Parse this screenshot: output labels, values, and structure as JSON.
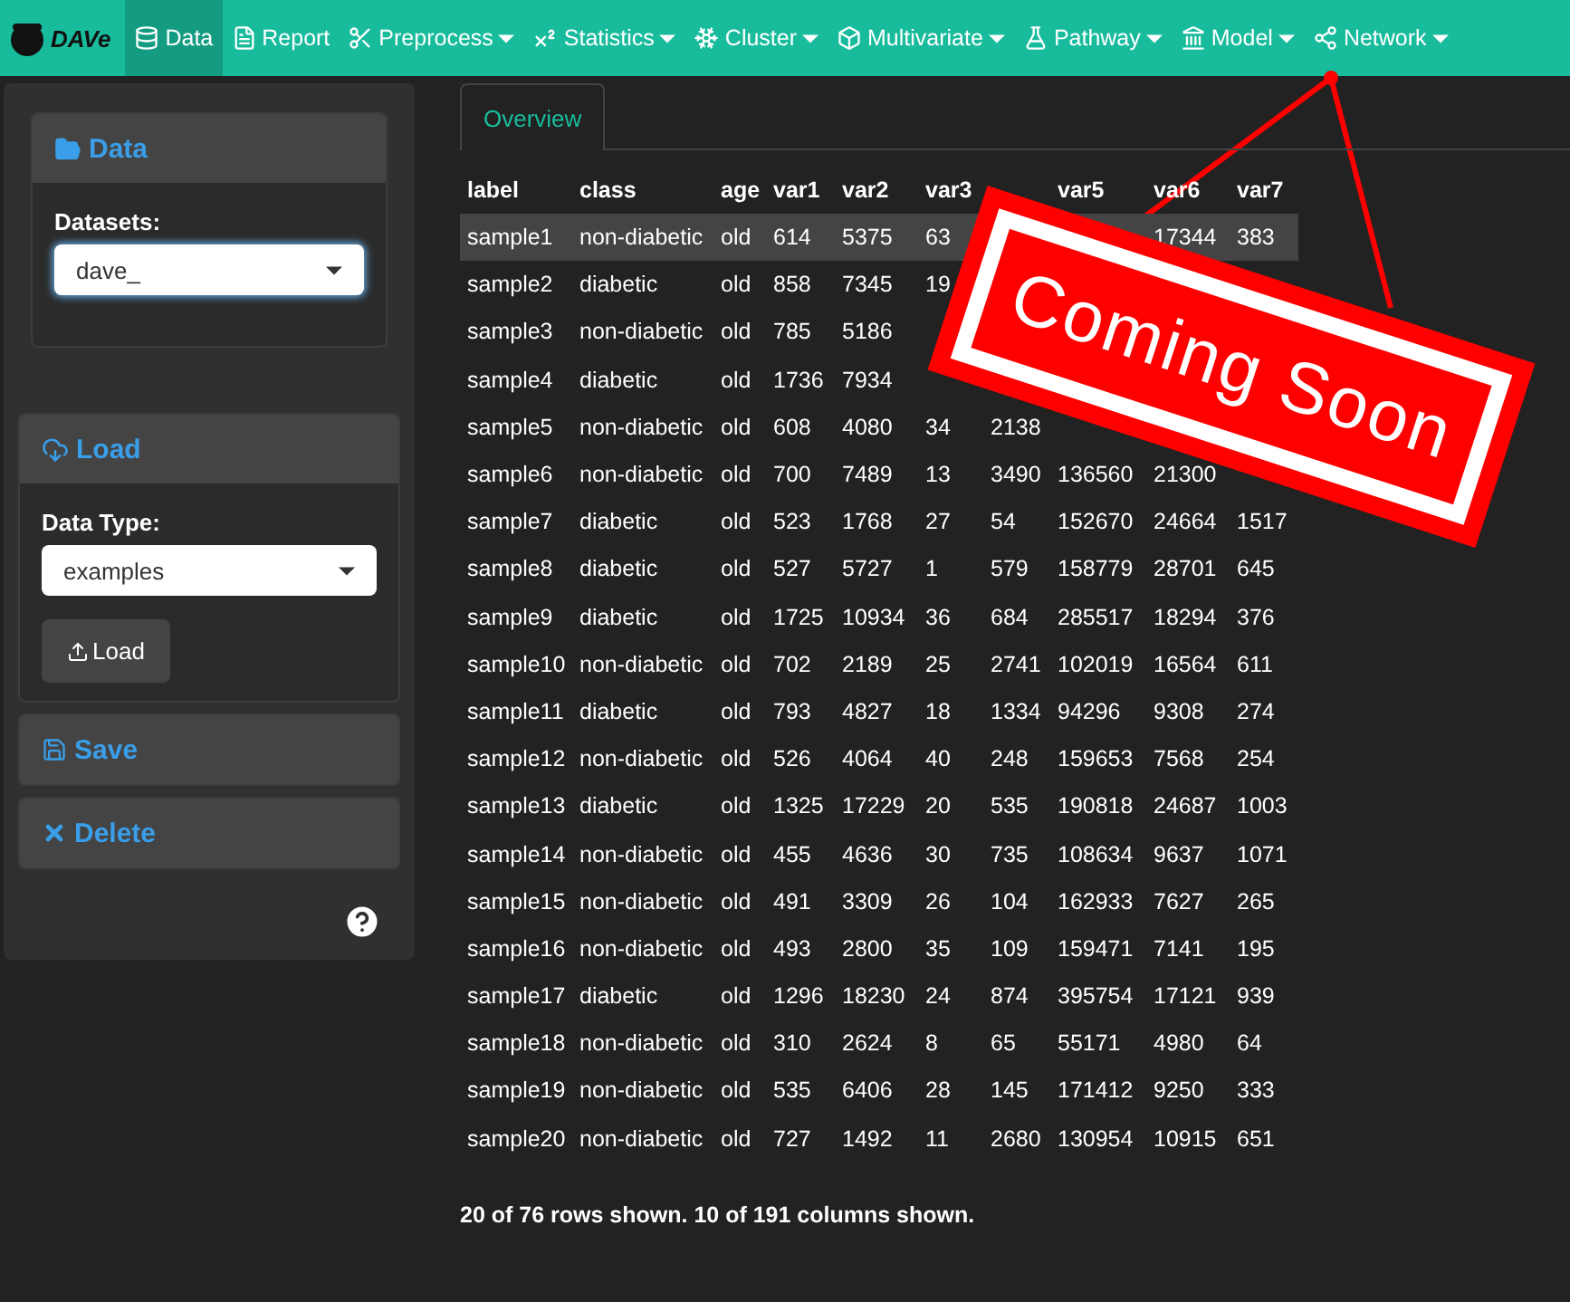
{
  "navbar": {
    "brand": "DAVe",
    "items": [
      {
        "label": "Data",
        "selected": true,
        "dropdown": false
      },
      {
        "label": "Report",
        "selected": false,
        "dropdown": false
      },
      {
        "label": "Preprocess",
        "selected": false,
        "dropdown": true
      },
      {
        "label": "Statistics",
        "selected": false,
        "dropdown": true
      },
      {
        "label": "Cluster",
        "selected": false,
        "dropdown": true
      },
      {
        "label": "Multivariate",
        "selected": false,
        "dropdown": true
      },
      {
        "label": "Pathway",
        "selected": false,
        "dropdown": true
      },
      {
        "label": "Model",
        "selected": false,
        "dropdown": true
      },
      {
        "label": "Network",
        "selected": false,
        "dropdown": true
      }
    ]
  },
  "sidebar": {
    "data_panel": {
      "title": "Data",
      "field_label": "Datasets:",
      "value": "dave_"
    },
    "load_panel": {
      "title": "Load",
      "field_label": "Data Type:",
      "value": "examples",
      "button": "Load"
    },
    "save_panel": {
      "title": "Save"
    },
    "delete_panel": {
      "title": "Delete"
    }
  },
  "tabs": [
    {
      "label": "Overview",
      "selected": true
    }
  ],
  "table": {
    "columns": [
      "label",
      "class",
      "age",
      "var1",
      "var2",
      "var3",
      null,
      "var5",
      "var6",
      "var7"
    ],
    "rows": [
      {
        "selected": true,
        "cells": [
          "sample1",
          "non-diabetic",
          "old",
          "614",
          "5375",
          "63",
          null,
          null,
          "17344",
          "383"
        ]
      },
      {
        "selected": false,
        "cells": [
          "sample2",
          "diabetic",
          "old",
          "858",
          "7345",
          "19",
          null,
          null,
          null,
          null
        ]
      },
      {
        "selected": false,
        "cells": [
          "sample3",
          "non-diabetic",
          "old",
          "785",
          "5186",
          null,
          null,
          null,
          null,
          null
        ]
      },
      {
        "selected": false,
        "cells": [
          "sample4",
          "diabetic",
          "old",
          "1736",
          "7934",
          null,
          null,
          null,
          null,
          null
        ]
      },
      {
        "selected": false,
        "cells": [
          "sample5",
          "non-diabetic",
          "old",
          "608",
          "4080",
          "34",
          "2138",
          null,
          null,
          null
        ]
      },
      {
        "selected": false,
        "cells": [
          "sample6",
          "non-diabetic",
          "old",
          "700",
          "7489",
          "13",
          "3490",
          "136560",
          "21300",
          null
        ]
      },
      {
        "selected": false,
        "cells": [
          "sample7",
          "diabetic",
          "old",
          "523",
          "1768",
          "27",
          "54",
          "152670",
          "24664",
          "1517"
        ]
      },
      {
        "selected": false,
        "cells": [
          "sample8",
          "diabetic",
          "old",
          "527",
          "5727",
          "1",
          "579",
          "158779",
          "28701",
          "645"
        ]
      },
      {
        "selected": false,
        "cells": [
          "sample9",
          "diabetic",
          "old",
          "1725",
          "10934",
          "36",
          "684",
          "285517",
          "18294",
          "376"
        ]
      },
      {
        "selected": false,
        "cells": [
          "sample10",
          "non-diabetic",
          "old",
          "702",
          "2189",
          "25",
          "2741",
          "102019",
          "16564",
          "611"
        ]
      },
      {
        "selected": false,
        "cells": [
          "sample11",
          "diabetic",
          "old",
          "793",
          "4827",
          "18",
          "1334",
          "94296",
          "9308",
          "274"
        ]
      },
      {
        "selected": false,
        "cells": [
          "sample12",
          "non-diabetic",
          "old",
          "526",
          "4064",
          "40",
          "248",
          "159653",
          "7568",
          "254"
        ]
      },
      {
        "selected": false,
        "cells": [
          "sample13",
          "diabetic",
          "old",
          "1325",
          "17229",
          "20",
          "535",
          "190818",
          "24687",
          "1003"
        ]
      },
      {
        "selected": false,
        "cells": [
          "sample14",
          "non-diabetic",
          "old",
          "455",
          "4636",
          "30",
          "735",
          "108634",
          "9637",
          "1071"
        ]
      },
      {
        "selected": false,
        "cells": [
          "sample15",
          "non-diabetic",
          "old",
          "491",
          "3309",
          "26",
          "104",
          "162933",
          "7627",
          "265"
        ]
      },
      {
        "selected": false,
        "cells": [
          "sample16",
          "non-diabetic",
          "old",
          "493",
          "2800",
          "35",
          "109",
          "159471",
          "7141",
          "195"
        ]
      },
      {
        "selected": false,
        "cells": [
          "sample17",
          "diabetic",
          "old",
          "1296",
          "18230",
          "24",
          "874",
          "395754",
          "17121",
          "939"
        ]
      },
      {
        "selected": false,
        "cells": [
          "sample18",
          "non-diabetic",
          "old",
          "310",
          "2624",
          "8",
          "65",
          "55171",
          "4980",
          "64"
        ]
      },
      {
        "selected": false,
        "cells": [
          "sample19",
          "non-diabetic",
          "old",
          "535",
          "6406",
          "28",
          "145",
          "171412",
          "9250",
          "333"
        ]
      },
      {
        "selected": false,
        "cells": [
          "sample20",
          "non-diabetic",
          "old",
          "727",
          "1492",
          "11",
          "2680",
          "130954",
          "10915",
          "651"
        ]
      }
    ]
  },
  "table_info": "20 of 76 rows shown. 10 of 191 columns shown.",
  "sign": {
    "text": "Coming Soon"
  }
}
